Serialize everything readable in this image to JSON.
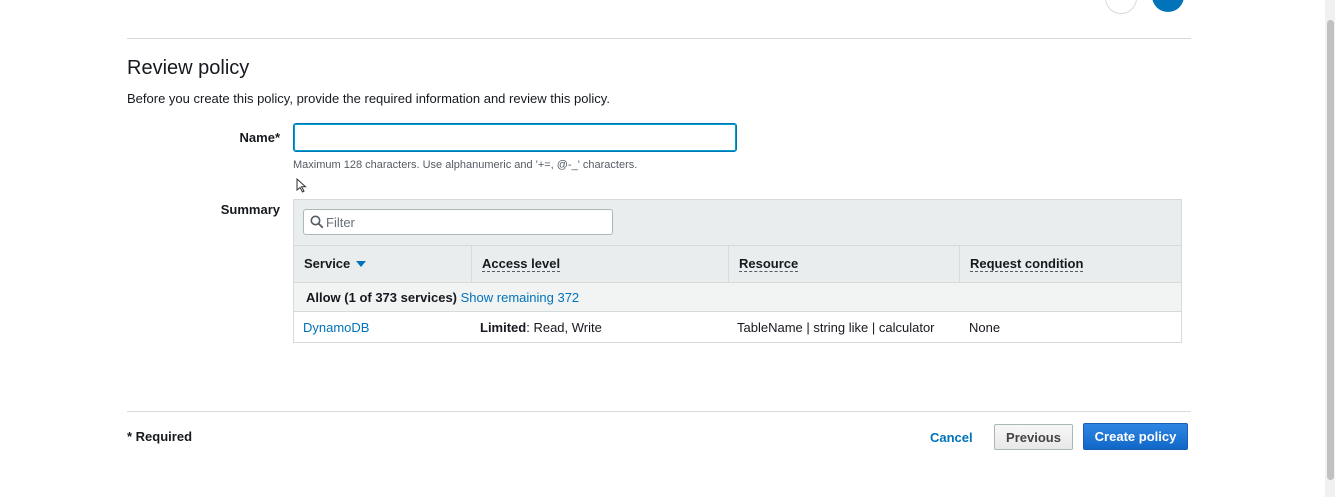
{
  "page": {
    "title": "Review policy",
    "description": "Before you create this policy, provide the required information and review this policy."
  },
  "name_field": {
    "label": "Name*",
    "value": "",
    "hint": "Maximum 128 characters. Use alphanumeric and '+=, @-_' characters."
  },
  "summary": {
    "label": "Summary",
    "filter_placeholder": "Filter",
    "columns": [
      "Service",
      "Access level",
      "Resource",
      "Request condition"
    ],
    "group": {
      "label": "Allow (1 of 373 services)",
      "link": "Show remaining 372"
    },
    "rows": [
      {
        "service": "DynamoDB",
        "access_level_bold": "Limited",
        "access_level_rest": ": Read, Write",
        "resource": "TableName | string like | calculator",
        "request_condition": "None"
      }
    ]
  },
  "footer": {
    "required_note": "* Required",
    "cancel_label": "Cancel",
    "previous_label": "Previous",
    "create_label": "Create policy"
  },
  "colors": {
    "link": "#0073bb",
    "primary_button": "#1067c7",
    "header_bg": "#eaeded"
  }
}
